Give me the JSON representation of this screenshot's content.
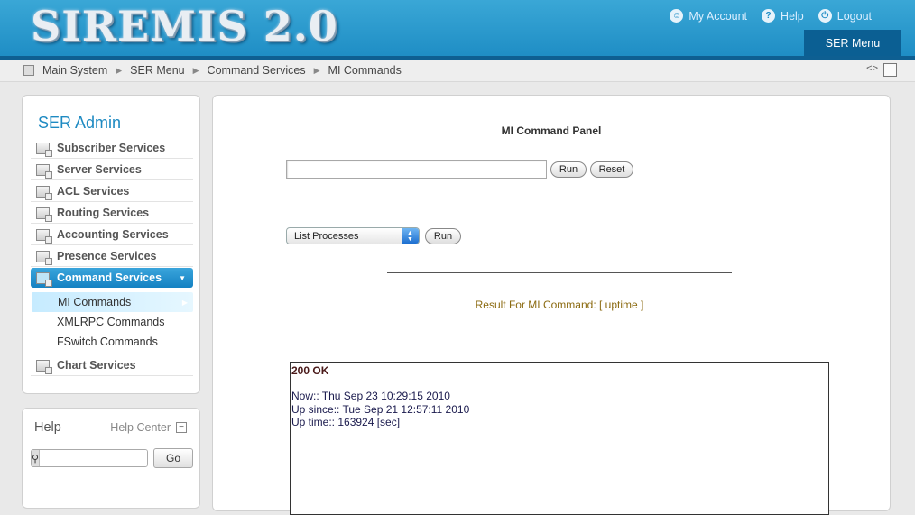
{
  "header": {
    "logo": "SIREMIS 2.0",
    "links": [
      {
        "label": "My Account",
        "icon": "user-icon"
      },
      {
        "label": "Help",
        "icon": "help-icon"
      },
      {
        "label": "Logout",
        "icon": "power-icon"
      }
    ],
    "active_tab": "SER Menu"
  },
  "breadcrumb": [
    "Main System",
    "SER Menu",
    "Command Services",
    "MI Commands"
  ],
  "sidebar": {
    "title": "SER Admin",
    "items": [
      {
        "label": "Subscriber Services"
      },
      {
        "label": "Server Services"
      },
      {
        "label": "ACL Services"
      },
      {
        "label": "Routing Services"
      },
      {
        "label": "Accounting Services"
      },
      {
        "label": "Presence Services"
      },
      {
        "label": "Command Services",
        "active": true
      },
      {
        "label": "Chart Services"
      }
    ],
    "subitems": [
      {
        "label": "MI Commands",
        "selected": true
      },
      {
        "label": "XMLRPC Commands"
      },
      {
        "label": "FSwitch Commands"
      }
    ]
  },
  "help": {
    "title": "Help",
    "center_label": "Help Center",
    "search_placeholder": "",
    "go_label": "Go"
  },
  "main": {
    "title": "MI Command Panel",
    "command_value": "",
    "run_label": "Run",
    "reset_label": "Reset",
    "select_value": "List Processes",
    "run2_label": "Run",
    "result_title": "Result For MI Command: [ uptime ]",
    "result_status": "200 OK",
    "result_lines": [
      "Now:: Thu Sep 23 10:29:15 2010",
      "Up since:: Tue Sep 21 12:57:11 2010",
      "Up time:: 163924 [sec]"
    ]
  },
  "colors": {
    "accent": "#1e8ac2",
    "active_item": "#1481c2",
    "result_title": "#8b6a10"
  }
}
